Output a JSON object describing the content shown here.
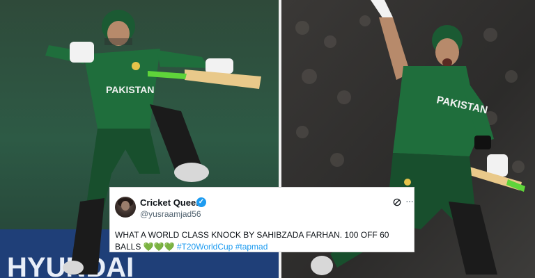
{
  "tweet": {
    "author_name": "Cricket Queen",
    "handle": "@yusraamjad56",
    "verified_icon": "verified-badge-icon",
    "text_main": "WHAT A WORLD CLASS KNOCK BY SAHIBZADA FARHAN. 100 OFF 60 BALLS",
    "hearts": "💚💚💚",
    "hashtag_1": "#T20WorldCup",
    "hashtag_2": "#tapmad",
    "colors": {
      "hashtag": "#1d9bf0",
      "verified": "#1d9bf0"
    }
  },
  "photo_left": {
    "jersey_text": "PAKISTAN",
    "banner_text": "HYUNDAI"
  },
  "photo_right": {
    "jersey_text": "PAKISTAN"
  },
  "icons": {
    "x_logo": "x-logo-icon",
    "more": "more-options-icon"
  }
}
